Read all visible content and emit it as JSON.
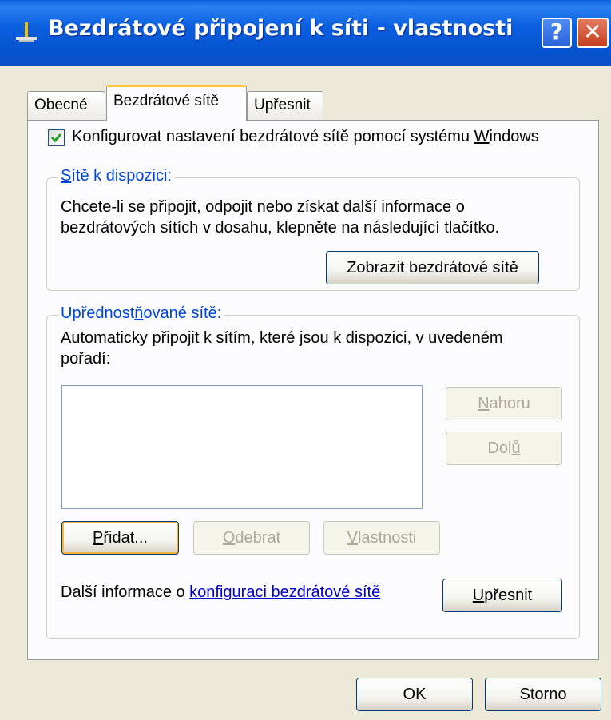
{
  "window": {
    "title": "Bezdrátové připojení k síti - vlastnosti",
    "help_button": "?",
    "close_button": "✕"
  },
  "tabs": [
    {
      "label": "Obecné",
      "selected": false
    },
    {
      "label": "Bezdrátové sítě",
      "selected": true
    },
    {
      "label": "Upřesnit",
      "selected": false
    }
  ],
  "configure_checkbox": {
    "checked": true,
    "label_prefix": "Konfigurovat nastavení bezdrátové sítě pomocí systému ",
    "label_accel": "W",
    "label_suffix": "indows"
  },
  "available_networks": {
    "legend_accel": "S",
    "legend_rest": "ítě k dispozici:",
    "description_line1": "Chcete-li se připojit, odpojit nebo získat další informace o",
    "description_line2": "bezdrátových sítích v dosahu, klepněte na následující tlačítko.",
    "view_button": "Zobrazit bezdrátové sítě"
  },
  "preferred_networks": {
    "legend_prefix": "Upřednost",
    "legend_accel": "ň",
    "legend_suffix": "ované sítě:",
    "description_line1": "Automaticky připojit k sítím, které jsou k dispozici, v uvedeném",
    "description_line2": "pořadí:",
    "items": [],
    "up_button_accel": "N",
    "up_button_rest": "ahoru",
    "down_button_prefix": "Dol",
    "down_button_accel": "ů",
    "add_button_accel": "P",
    "add_button_rest": "řidat...",
    "remove_button_accel": "O",
    "remove_button_rest": "debrat",
    "properties_button_accel": "V",
    "properties_button_rest": "lastnosti",
    "info_prefix": "Další informace o ",
    "info_link": "konfiguraci bezdrátové sítě",
    "advanced_button_accel": "U",
    "advanced_button_rest": "přesnit"
  },
  "footer": {
    "ok_button": "OK",
    "cancel_button": "Storno"
  },
  "colors": {
    "titlebar": "#0A5FD8",
    "dialog_bg": "#ECE9D8",
    "group_label": "#0046D5",
    "link": "#0000CC",
    "active_tab_accent": "#FFC83C"
  }
}
